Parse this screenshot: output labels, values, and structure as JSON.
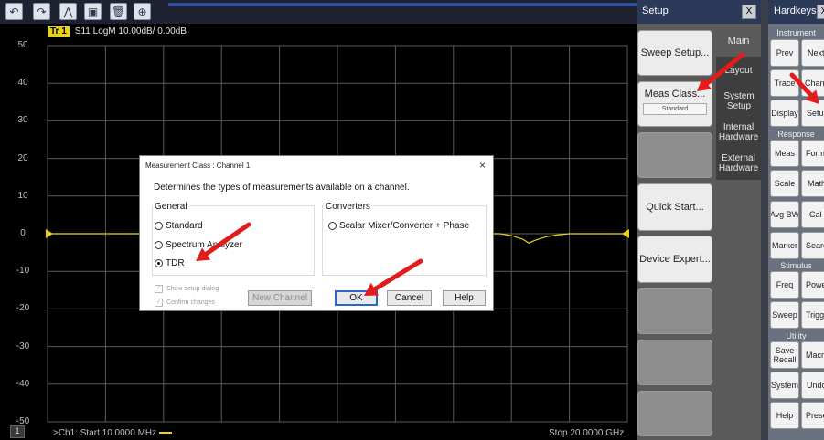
{
  "toolbar": {
    "buttons": [
      {
        "name": "undo-button",
        "icon": "↶"
      },
      {
        "name": "redo-button",
        "icon": "↷"
      },
      {
        "name": "marker-button",
        "icon": "⋀"
      },
      {
        "name": "save-button",
        "icon": "▣"
      },
      {
        "name": "trash-button",
        "icon": "🗑"
      },
      {
        "name": "zoom-button",
        "icon": "⊕"
      }
    ]
  },
  "trace": {
    "tag": "Tr 1",
    "header": "S11 LogM 10.00dB/ 0.00dB",
    "color": "#e8d21c"
  },
  "chart_data": {
    "type": "line",
    "ylim": [
      -50,
      50
    ],
    "yticks": [
      "50",
      "40",
      "30",
      "20",
      "10",
      "0",
      "-10",
      "-20",
      "-30",
      "-40",
      "-50"
    ],
    "reference_level": 0,
    "series": [
      {
        "x_fraction": [
          0,
          0.3,
          0.7,
          0.78,
          0.8,
          0.82,
          0.83,
          0.84,
          0.86,
          0.88,
          0.9,
          1.0
        ],
        "values": [
          0,
          0,
          0,
          0,
          -0.5,
          -1.5,
          -2.5,
          -1.8,
          -0.8,
          -0.3,
          0,
          0
        ]
      }
    ]
  },
  "status": {
    "start": ">Ch1: Start  10.0000 MHz",
    "stop": "Stop  20.0000 GHz",
    "channel": "1"
  },
  "setup": {
    "title": "Setup",
    "close": "X",
    "buttons": [
      "Sweep Setup...",
      "Meas Class...",
      "",
      "Quick Start...",
      "Device Expert...",
      "",
      "",
      "",
      ""
    ],
    "meas_class_value": "Standard",
    "tabs": [
      "Main",
      "Layout",
      "System Setup",
      "Internal Hardware",
      "External Hardware"
    ]
  },
  "hardkeys": {
    "title": "Hardkeys",
    "close": "X",
    "sections": {
      "instrument": "Instrument",
      "response": "Response",
      "stimulus": "Stimulus",
      "utility": "Utility"
    },
    "keys": {
      "prev": "Prev",
      "next": "Next",
      "trace": "Trace",
      "channel": "Channel",
      "display": "Display",
      "setup": "Setup",
      "meas": "Meas",
      "format": "Format",
      "scale": "Scale",
      "math": "Math",
      "avgbw": "Avg BW",
      "cal": "Cal",
      "marker": "Marker",
      "search": "Search",
      "freq": "Freq",
      "power": "Power",
      "sweep": "Sweep",
      "trigger": "Trigger",
      "saverecall": "Save Recall",
      "macro": "Macro",
      "system": "System",
      "undo": "Undo",
      "help": "Help",
      "preset": "Preset"
    }
  },
  "dialog": {
    "title": "Measurement Class : Channel 1",
    "close": "×",
    "description": "Determines the types of measurements available on a channel.",
    "general_label": "General",
    "converters_label": "Converters",
    "options": [
      "Standard",
      "Spectrum Analyzer",
      "TDR"
    ],
    "selected": "TDR",
    "converter_option": "Scalar Mixer/Converter + Phase",
    "show_setup": "Show setup dialog",
    "confirm_changes": "Confirm changes",
    "new_channel": "New Channel",
    "ok": "OK",
    "cancel": "Cancel",
    "help": "Help"
  },
  "colors": {
    "annotation_arrow": "#e21c1c",
    "grid": "#5a5a5a",
    "trace": "#e8d21c"
  }
}
